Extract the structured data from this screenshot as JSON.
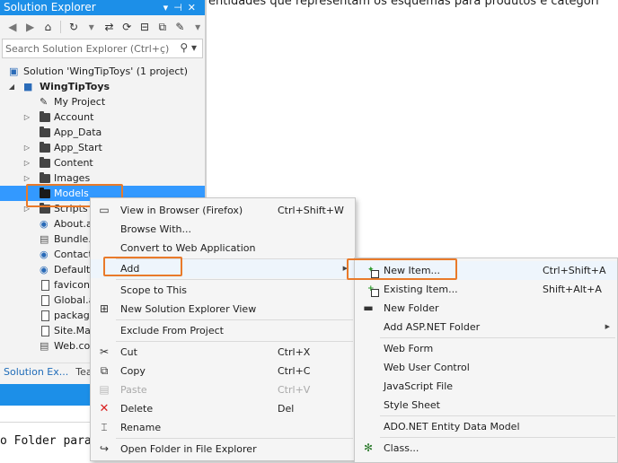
{
  "doc": {
    "top_text": "entidades que representam os esquemas para produtos e categori",
    "bottom_text": "o Folder para M"
  },
  "solution_explorer": {
    "title": "Solution Explorer",
    "search_placeholder": "Search Solution Explorer (Ctrl+ç)",
    "tree": [
      {
        "label": "Solution 'WingTipToys' (1 project)",
        "icon": "solution-icon"
      },
      {
        "label": "WingTipToys",
        "icon": "project-icon"
      },
      {
        "label": "My Project",
        "icon": "wrench-icon"
      },
      {
        "label": "Account",
        "icon": "folder-icon"
      },
      {
        "label": "App_Data",
        "icon": "folder-icon"
      },
      {
        "label": "App_Start",
        "icon": "folder-icon"
      },
      {
        "label": "Content",
        "icon": "folder-icon"
      },
      {
        "label": "Images",
        "icon": "folder-icon"
      },
      {
        "label": "Models",
        "icon": "folder-icon"
      },
      {
        "label": "Scripts",
        "icon": "folder-icon"
      },
      {
        "label": "About.a",
        "icon": "web-file-icon"
      },
      {
        "label": "Bundle.c",
        "icon": "config-file-icon"
      },
      {
        "label": "Contact",
        "icon": "web-file-icon"
      },
      {
        "label": "Default.",
        "icon": "web-file-icon"
      },
      {
        "label": "favicon.",
        "icon": "file-icon"
      },
      {
        "label": "Global.a",
        "icon": "file-icon"
      },
      {
        "label": "package",
        "icon": "file-icon"
      },
      {
        "label": "Site.Mas",
        "icon": "file-icon"
      },
      {
        "label": "Web.co",
        "icon": "config-file-icon"
      }
    ],
    "tabs": [
      "Solution Ex...",
      "Tea"
    ]
  },
  "context_menu": {
    "items": [
      {
        "label": "View in Browser (Firefox)",
        "shortcut": "Ctrl+Shift+W"
      },
      {
        "label": "Browse With...",
        "shortcut": ""
      },
      {
        "label": "Convert to Web Application",
        "shortcut": ""
      },
      {
        "label": "Add",
        "shortcut": ""
      },
      {
        "label": "Scope to This",
        "shortcut": ""
      },
      {
        "label": "New Solution Explorer View",
        "shortcut": ""
      },
      {
        "label": "Exclude From Project",
        "shortcut": ""
      },
      {
        "label": "Cut",
        "shortcut": "Ctrl+X"
      },
      {
        "label": "Copy",
        "shortcut": "Ctrl+C"
      },
      {
        "label": "Paste",
        "shortcut": "Ctrl+V"
      },
      {
        "label": "Delete",
        "shortcut": "Del"
      },
      {
        "label": "Rename",
        "shortcut": ""
      },
      {
        "label": "Open Folder in File Explorer",
        "shortcut": ""
      }
    ]
  },
  "add_submenu": {
    "items": [
      {
        "label": "New Item...",
        "shortcut": "Ctrl+Shift+A"
      },
      {
        "label": "Existing Item...",
        "shortcut": "Shift+Alt+A"
      },
      {
        "label": "New Folder",
        "shortcut": ""
      },
      {
        "label": "Add ASP.NET Folder",
        "shortcut": ""
      },
      {
        "label": "Web Form",
        "shortcut": ""
      },
      {
        "label": "Web User Control",
        "shortcut": ""
      },
      {
        "label": "JavaScript File",
        "shortcut": ""
      },
      {
        "label": "Style Sheet",
        "shortcut": ""
      },
      {
        "label": "ADO.NET Entity Data Model",
        "shortcut": ""
      },
      {
        "label": "Class...",
        "shortcut": ""
      }
    ]
  },
  "colors": {
    "accent": "#1c8fe8",
    "selection": "#3399ff",
    "highlight_box": "#e97a2a"
  }
}
